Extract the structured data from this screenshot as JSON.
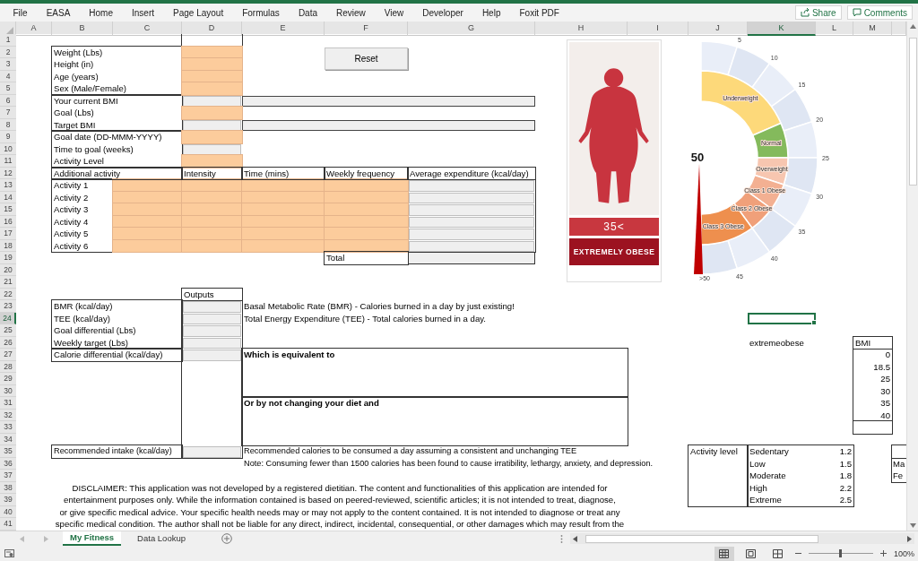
{
  "menu": [
    "File",
    "EASA",
    "Home",
    "Insert",
    "Page Layout",
    "Formulas",
    "Data",
    "Review",
    "View",
    "Developer",
    "Help",
    "Foxit PDF"
  ],
  "ribbon_buttons": [
    "Share",
    "Comments"
  ],
  "columns": [
    {
      "label": "A",
      "selected": false
    },
    {
      "label": "B",
      "selected": false
    },
    {
      "label": "C",
      "selected": false
    },
    {
      "label": "D",
      "selected": false
    },
    {
      "label": "E",
      "selected": false
    },
    {
      "label": "F",
      "selected": false
    },
    {
      "label": "G",
      "selected": false
    },
    {
      "label": "H",
      "selected": false
    },
    {
      "label": "I",
      "selected": false
    },
    {
      "label": "J",
      "selected": false
    },
    {
      "label": "K",
      "selected": true
    },
    {
      "label": "L",
      "selected": false
    },
    {
      "label": "M",
      "selected": false
    }
  ],
  "rows": [
    {
      "label": "1",
      "selected": false
    },
    {
      "label": "2",
      "selected": false
    },
    {
      "label": "3",
      "selected": false
    },
    {
      "label": "4",
      "selected": false
    },
    {
      "label": "5",
      "selected": false
    },
    {
      "label": "6",
      "selected": false
    },
    {
      "label": "7",
      "selected": false
    },
    {
      "label": "8",
      "selected": false
    },
    {
      "label": "9",
      "selected": false
    },
    {
      "label": "10",
      "selected": false
    },
    {
      "label": "11",
      "selected": false
    },
    {
      "label": "12",
      "selected": false
    },
    {
      "label": "13",
      "selected": false
    },
    {
      "label": "14",
      "selected": false
    },
    {
      "label": "15",
      "selected": false
    },
    {
      "label": "16",
      "selected": false
    },
    {
      "label": "17",
      "selected": false
    },
    {
      "label": "18",
      "selected": false
    },
    {
      "label": "19",
      "selected": false
    },
    {
      "label": "20",
      "selected": false
    },
    {
      "label": "21",
      "selected": false
    },
    {
      "label": "22",
      "selected": false
    },
    {
      "label": "23",
      "selected": false
    },
    {
      "label": "24",
      "selected": true
    },
    {
      "label": "25",
      "selected": false
    },
    {
      "label": "26",
      "selected": false
    },
    {
      "label": "27",
      "selected": false
    },
    {
      "label": "28",
      "selected": false
    },
    {
      "label": "29",
      "selected": false
    },
    {
      "label": "30",
      "selected": false
    },
    {
      "label": "31",
      "selected": false
    },
    {
      "label": "32",
      "selected": false
    },
    {
      "label": "33",
      "selected": false
    },
    {
      "label": "34",
      "selected": false
    },
    {
      "label": "35",
      "selected": false
    },
    {
      "label": "36",
      "selected": false
    },
    {
      "label": "37",
      "selected": false
    },
    {
      "label": "38",
      "selected": false
    },
    {
      "label": "39",
      "selected": false
    },
    {
      "label": "40",
      "selected": false
    },
    {
      "label": "41",
      "selected": false
    }
  ],
  "form": {
    "reset_button": "Reset",
    "fields": [
      {
        "label": "Weight (Lbs)",
        "kind": "input"
      },
      {
        "label": "Height (in)",
        "kind": "input"
      },
      {
        "label": "Age (years)",
        "kind": "input"
      },
      {
        "label": "Sex (Male/Female)",
        "kind": "input"
      },
      {
        "label": "Your current BMI",
        "kind": "output_wide"
      },
      {
        "label": "Goal (Lbs)",
        "kind": "input"
      },
      {
        "label": "Target BMI",
        "kind": "output_wide"
      },
      {
        "label": "Goal date (DD-MMM-YYYY)",
        "kind": "input"
      },
      {
        "label": "Time to goal (weeks)",
        "kind": "output"
      },
      {
        "label": "Activity Level",
        "kind": "input"
      }
    ]
  },
  "activities": {
    "headers": [
      "Additional activity",
      "Intensity",
      "Time (mins)",
      "Weekly frequency",
      "Average expenditure (kcal/day)"
    ],
    "rows": [
      "Activity 1",
      "Activity 2",
      "Activity 3",
      "Activity 4",
      "Activity 5",
      "Activity 6"
    ],
    "total_label": "Total"
  },
  "outputs": {
    "header": "Outputs",
    "items": [
      {
        "label": "BMR (kcal/day)",
        "note": "Basal Metabolic Rate (BMR) - Calories burned in a day by just existing!"
      },
      {
        "label": "TEE (kcal/day)",
        "note": "Total Energy Expenditure (TEE) - Total calories burned in a day."
      },
      {
        "label": "Goal differential (Lbs)"
      },
      {
        "label": "Weekly target (Lbs)"
      },
      {
        "label": "Calorie differential (kcal/day)"
      }
    ]
  },
  "equivalent": {
    "title": "Which is equivalent to",
    "alternative": "Or by not changing your diet and"
  },
  "recommended": {
    "label": "Recommended intake (kcal/day)",
    "note": "Recommended calories to be consumed a day assuming a consistent and unchanging TEE",
    "warning": "Note: Consuming fewer than 1500 calories has been found to cause irratibility, lethargy, anxiety, and depression."
  },
  "disclaimer": [
    "DISCLAIMER: This application was not developed by a registered dietitian. The content and functionalities of this application are intended for",
    "entertainment purposes only. While the information contained is based on peered-reviewed, scientific articles; it is not intended to treat, diagnose,",
    "or give specific medical advice. Your specific health needs may or may not apply to the content contained. It is not intended to diagnose or treat any",
    "specific medical condition. The author shall not be liable for any direct, indirect, incidental, consequential, or other damages which may result from the"
  ],
  "figure": {
    "value": "35<",
    "category": "EXTREMELY OBESE"
  },
  "gauge": {
    "value": "50",
    "ticks": [
      "5",
      "10",
      "15",
      "20",
      "25",
      "30",
      "35",
      "40",
      "45",
      ">50"
    ],
    "bands": [
      {
        "label": "Underweight",
        "color": "#fdd97a"
      },
      {
        "label": "Normal",
        "color": "#84ba5c"
      },
      {
        "label": "Overweight",
        "color": "#f7c6b0"
      },
      {
        "label": "Class 1 Obese",
        "color": "#f3b092"
      },
      {
        "label": "Class 2 Obese",
        "color": "#f0a07a"
      },
      {
        "label": "Class 3 Obese",
        "color": "#ee8f4e"
      }
    ]
  },
  "lookup": {
    "status": "extremeobese",
    "bmi_header": "BMI",
    "bmi_values": [
      "0",
      "18.5",
      "25",
      "30",
      "35",
      "40"
    ]
  },
  "activity_levels": {
    "label": "Activity level",
    "levels": [
      {
        "name": "Sedentary",
        "factor": "1.2"
      },
      {
        "name": "Low",
        "factor": "1.5"
      },
      {
        "name": "Moderate",
        "factor": "1.8"
      },
      {
        "name": "High",
        "factor": "2.2"
      },
      {
        "name": "Extreme",
        "factor": "2.5"
      }
    ]
  },
  "sex_table": [
    "Ma",
    "Fe"
  ],
  "sheet_tabs": [
    {
      "label": "My Fitness",
      "selected": true
    },
    {
      "label": "Data Lookup",
      "selected": false
    }
  ],
  "status_bar": {
    "zoom": "100%",
    "level": 0.5
  }
}
